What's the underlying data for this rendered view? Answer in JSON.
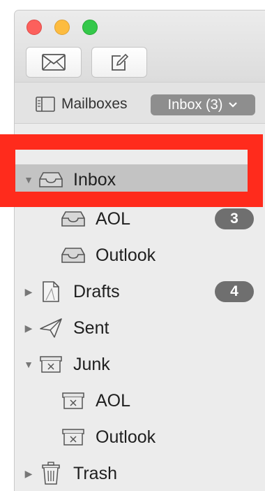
{
  "window": {
    "traffic_lights": [
      "close",
      "minimize",
      "zoom"
    ]
  },
  "toolbar": {
    "get_mail_icon": "envelope-icon",
    "compose_icon": "compose-icon"
  },
  "favorites": {
    "mailboxes_label": "Mailboxes",
    "inbox_button_label": "Inbox (3)"
  },
  "sidebar": {
    "section_header": "Mailboxes",
    "items": [
      {
        "label": "Inbox",
        "icon": "inbox-tray-icon",
        "expanded": true,
        "selected": true,
        "badge": ""
      },
      {
        "label": "AOL",
        "icon": "inbox-tray-icon",
        "child": true,
        "badge": "3"
      },
      {
        "label": "Outlook",
        "icon": "inbox-tray-icon",
        "child": true,
        "badge": ""
      },
      {
        "label": "Drafts",
        "icon": "drafts-page-icon",
        "expanded": false,
        "badge": "4"
      },
      {
        "label": "Sent",
        "icon": "paper-plane-icon",
        "expanded": false,
        "badge": ""
      },
      {
        "label": "Junk",
        "icon": "junk-box-icon",
        "expanded": true,
        "badge": ""
      },
      {
        "label": "AOL",
        "icon": "junk-box-icon",
        "child": true,
        "badge": ""
      },
      {
        "label": "Outlook",
        "icon": "junk-box-icon",
        "child": true,
        "badge": ""
      },
      {
        "label": "Trash",
        "icon": "trash-can-icon",
        "expanded": false,
        "badge": ""
      }
    ]
  },
  "annotation": {
    "highlight_color": "#ff2b1c",
    "highlighted_item": "Inbox"
  }
}
